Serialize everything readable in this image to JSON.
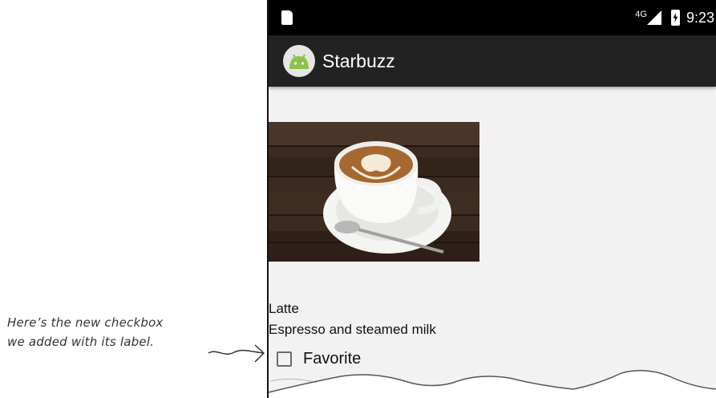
{
  "status_bar": {
    "network": "4G",
    "time": "9:23",
    "icons": [
      "sd-card-icon",
      "signal-icon",
      "battery-charging-icon"
    ]
  },
  "action_bar": {
    "title": "Starbuzz",
    "icon": "android-app-icon",
    "background": "#222222"
  },
  "drink": {
    "image": "latte-cup-photo",
    "name": "Latte",
    "description": "Espresso and steamed milk"
  },
  "favorite_checkbox": {
    "label": "Favorite",
    "checked": false
  },
  "annotation": {
    "line1": "Here’s the new checkbox",
    "line2": "we added with its label."
  }
}
